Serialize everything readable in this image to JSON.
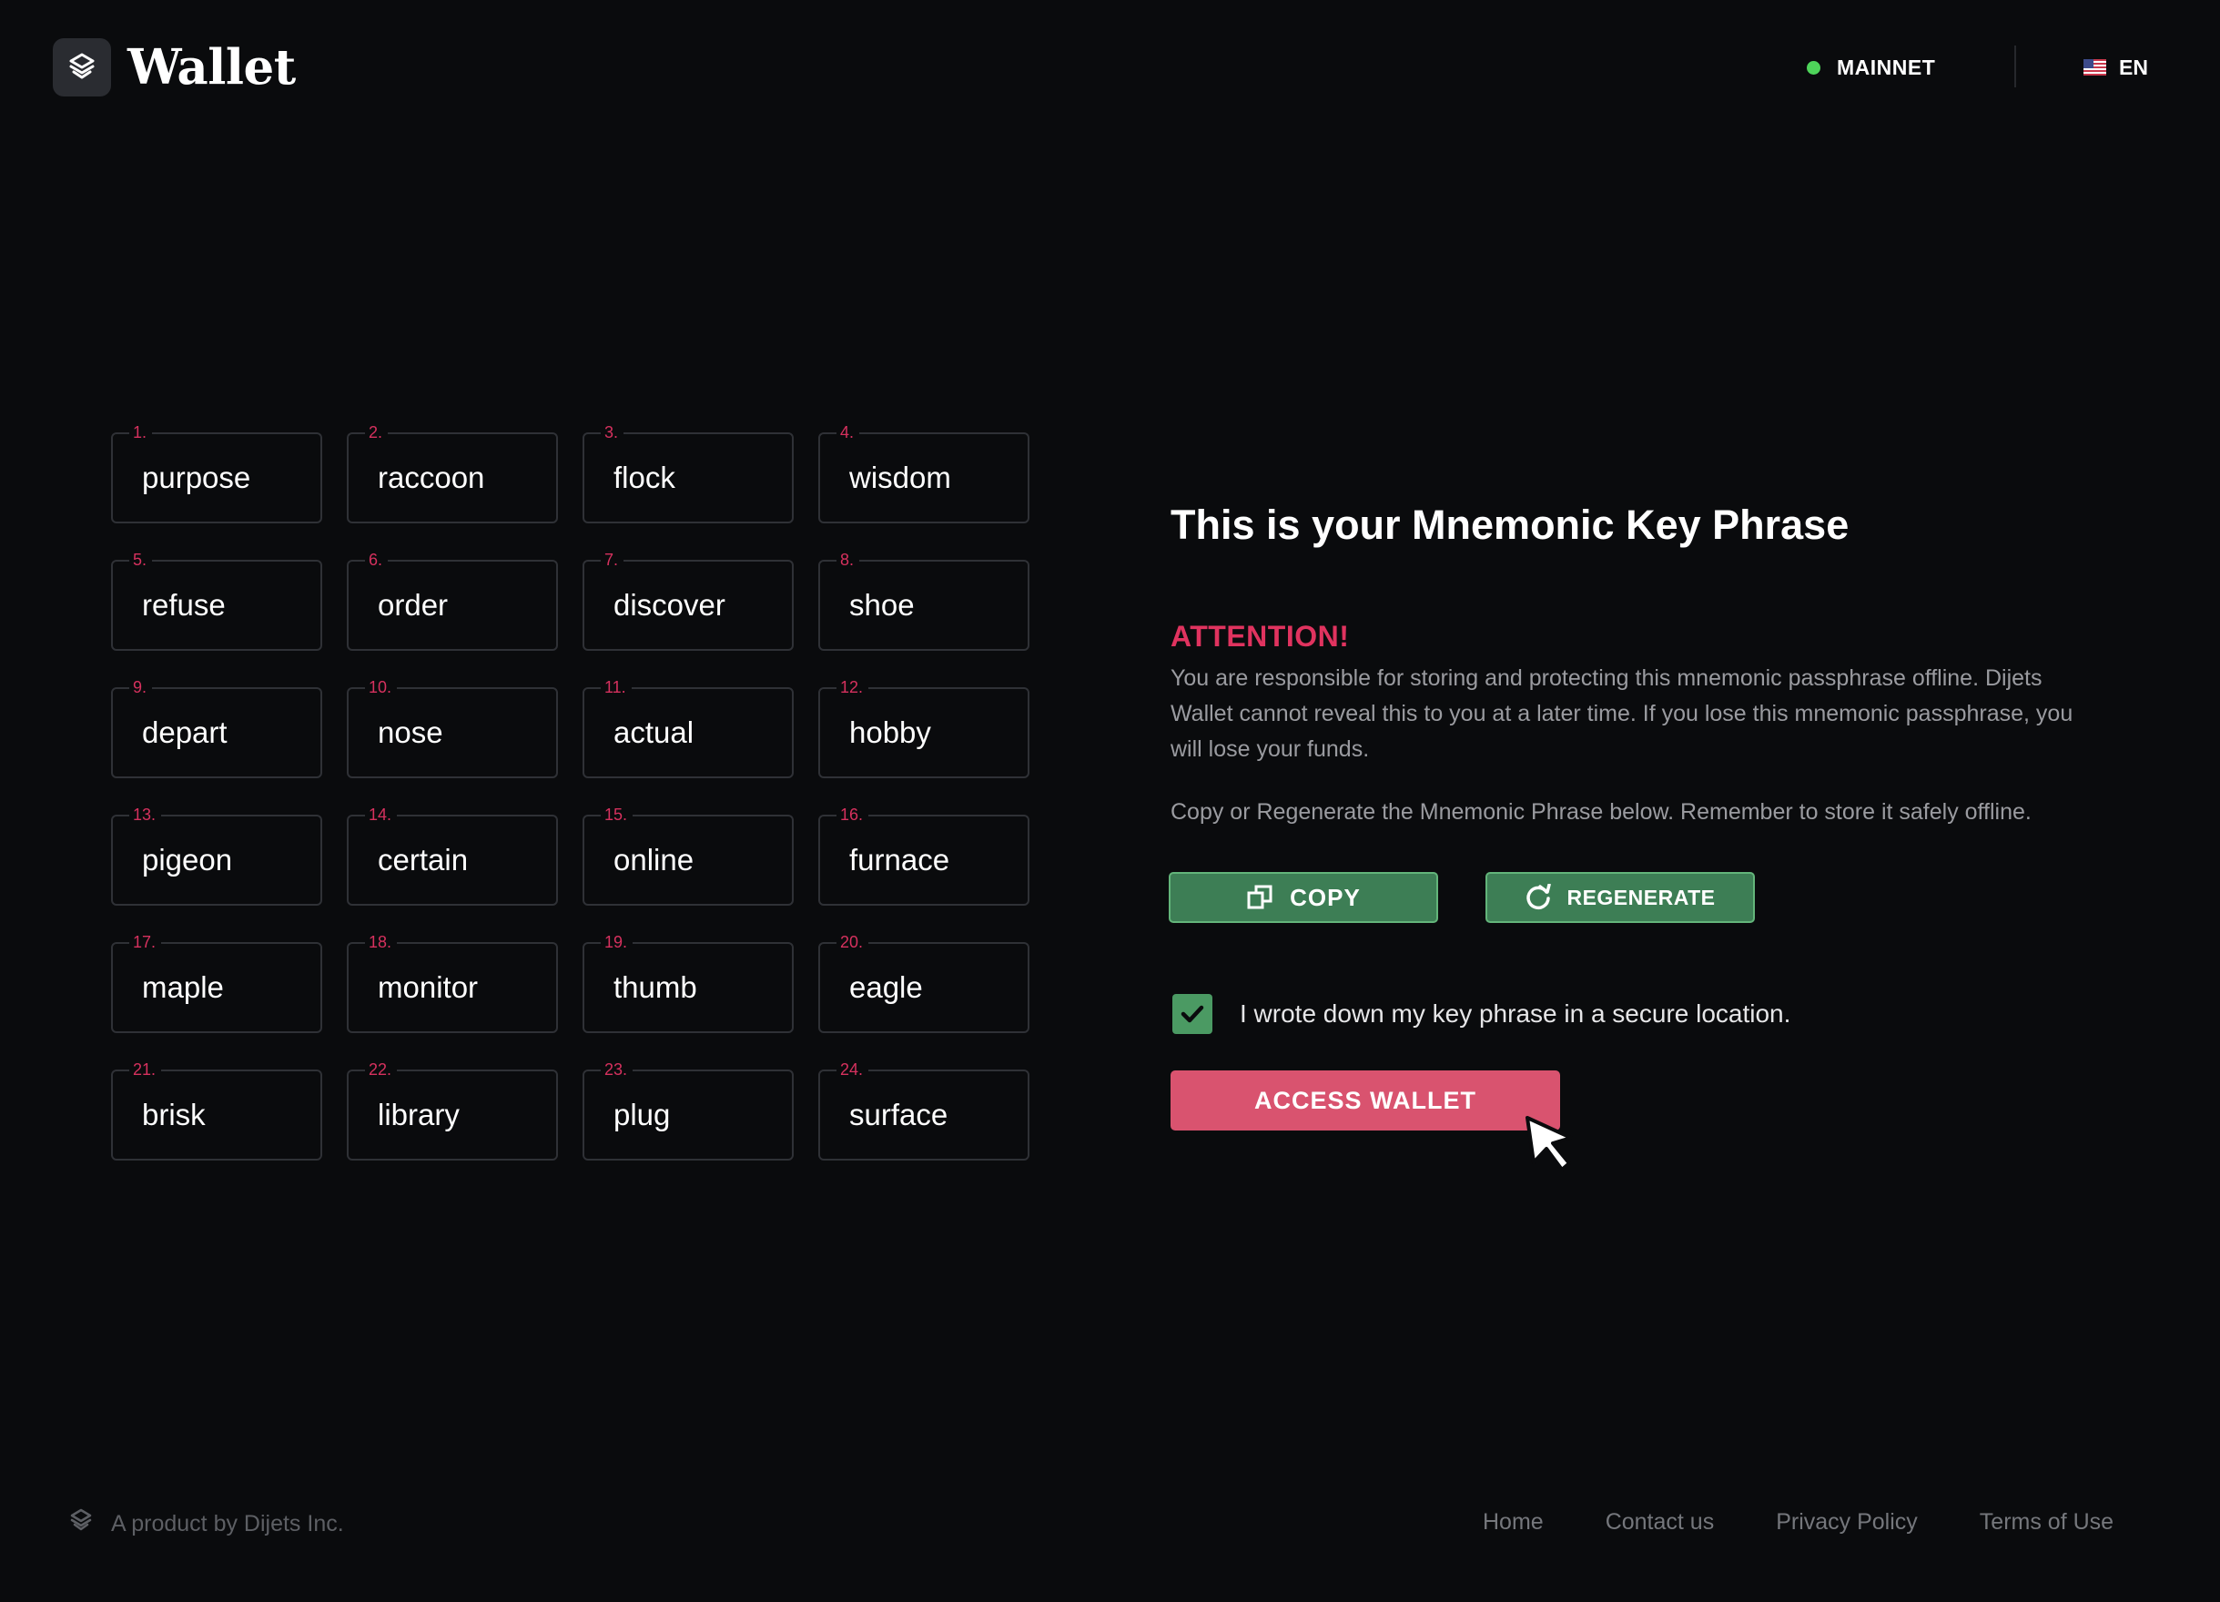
{
  "header": {
    "brand": "Wallet",
    "network_label": "MAINNET",
    "network_status_color": "#4ed45a",
    "language": "EN",
    "logo_icon": "dijets-logo-icon",
    "flag_icon": "us-flag-icon"
  },
  "mnemonic": {
    "words": [
      {
        "num": "1.",
        "word": "purpose"
      },
      {
        "num": "2.",
        "word": "raccoon"
      },
      {
        "num": "3.",
        "word": "flock"
      },
      {
        "num": "4.",
        "word": "wisdom"
      },
      {
        "num": "5.",
        "word": "refuse"
      },
      {
        "num": "6.",
        "word": "order"
      },
      {
        "num": "7.",
        "word": "discover"
      },
      {
        "num": "8.",
        "word": "shoe"
      },
      {
        "num": "9.",
        "word": "depart"
      },
      {
        "num": "10.",
        "word": "nose"
      },
      {
        "num": "11.",
        "word": "actual"
      },
      {
        "num": "12.",
        "word": "hobby"
      },
      {
        "num": "13.",
        "word": "pigeon"
      },
      {
        "num": "14.",
        "word": "certain"
      },
      {
        "num": "15.",
        "word": "online"
      },
      {
        "num": "16.",
        "word": "furnace"
      },
      {
        "num": "17.",
        "word": "maple"
      },
      {
        "num": "18.",
        "word": "monitor"
      },
      {
        "num": "19.",
        "word": "thumb"
      },
      {
        "num": "20.",
        "word": "eagle"
      },
      {
        "num": "21.",
        "word": "brisk"
      },
      {
        "num": "22.",
        "word": "library"
      },
      {
        "num": "23.",
        "word": "plug"
      },
      {
        "num": "24.",
        "word": "surface"
      }
    ]
  },
  "panel": {
    "title": "This is your Mnemonic Key Phrase",
    "attention": "ATTENTION!",
    "warning": "You are responsible for storing and protecting this mnemonic passphrase offline. Dijets Wallet cannot reveal this to you at a later time. If you lose this mnemonic passphrase, you will lose your funds.",
    "instruction": "Copy or Regenerate the Mnemonic Phrase below. Remember to store it safely offline.",
    "copy_label": "COPY",
    "copy_icon": "copy-icon",
    "regenerate_label": "REGENERATE",
    "regenerate_icon": "refresh-icon",
    "checkbox_checked": true,
    "checkbox_label": "I wrote down my key phrase in a secure location.",
    "access_label": "ACCESS WALLET"
  },
  "colors": {
    "background": "#0a0b0d",
    "accent_red": "#e0335f",
    "button_green": "#3d7e55",
    "button_pink": "#d9536f"
  },
  "footer": {
    "credit": "A product by Dijets Inc.",
    "links": [
      "Home",
      "Contact us",
      "Privacy Policy",
      "Terms of Use"
    ]
  }
}
